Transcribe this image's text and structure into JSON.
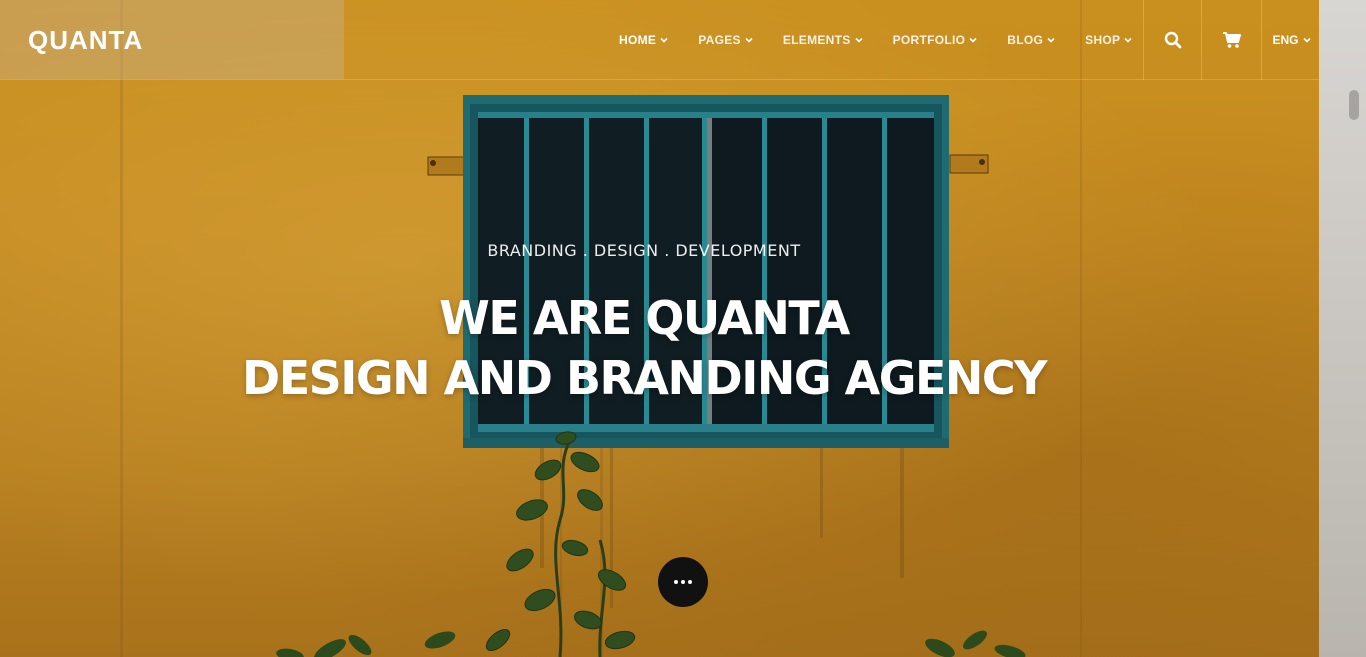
{
  "brand": {
    "logo_text": "QUANTA"
  },
  "nav": {
    "items": [
      {
        "label": "HOME",
        "active": true
      },
      {
        "label": "PAGES",
        "active": false
      },
      {
        "label": "ELEMENTS",
        "active": false
      },
      {
        "label": "PORTFOLIO",
        "active": false
      },
      {
        "label": "BLOG",
        "active": false
      },
      {
        "label": "SHOP",
        "active": false
      }
    ]
  },
  "tools": {
    "search_icon": "search-icon",
    "cart_icon": "shopping-cart-icon",
    "language": "ENG"
  },
  "hero": {
    "subtitle": "BRANDING . DESIGN . DEVELOPMENT",
    "title_line1": "WE ARE QUANTA",
    "title_line2": "DESIGN AND BRANDING AGENCY",
    "scroll_icon": "more-dots-icon"
  },
  "colors": {
    "wall": "#c88a25",
    "window_frame": "#1f6b72",
    "window_glass": "#0e1a1f",
    "button_bg": "#111111",
    "text": "#ffffff"
  }
}
